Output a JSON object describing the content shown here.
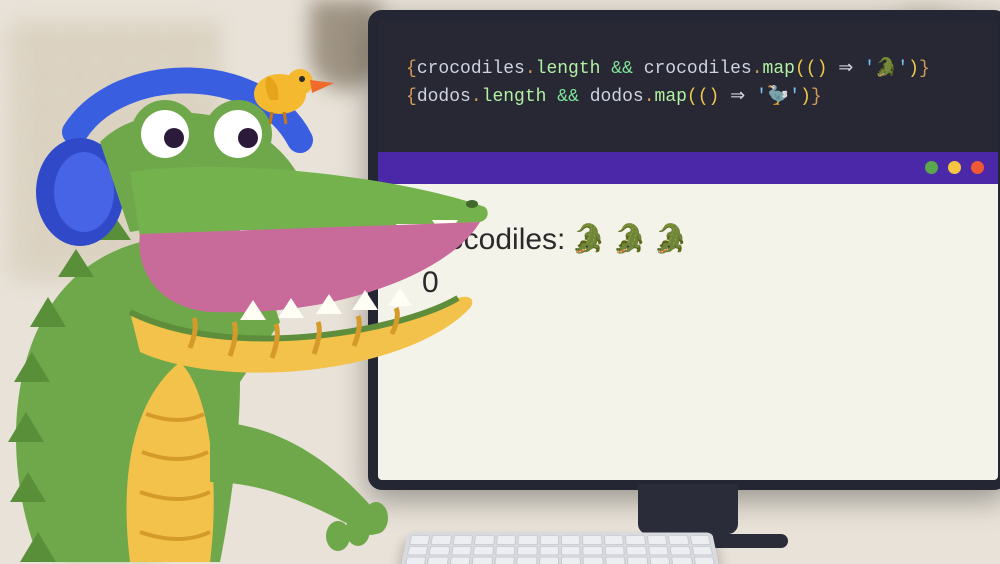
{
  "code": {
    "line1": {
      "open": "{",
      "ident1": "crocodiles",
      "dot1": ".",
      "prop1": "length",
      "sp1": " ",
      "and": "&&",
      "sp2": " ",
      "ident2": "crocodiles",
      "dot2": ".",
      "prop2": "map",
      "paren_open": "((",
      "paren_close1": ")",
      "sp3": " ",
      "arrow": "⇒",
      "sp4": " ",
      "str_open": "'",
      "emoji": "🐊",
      "str_close": "'",
      "paren_close2": ")",
      "close": "}"
    },
    "line2": {
      "open": "{",
      "ident1": "dodos",
      "dot1": ".",
      "prop1": "length",
      "sp1": " ",
      "and": "&&",
      "sp2": " ",
      "ident2": "dodos",
      "dot2": ".",
      "prop2": "map",
      "paren_open": "((",
      "paren_close1": ")",
      "sp3": " ",
      "arrow": "⇒",
      "sp4": " ",
      "str_open": "'",
      "emoji": "🦤",
      "str_close": "'",
      "paren_close2": ")",
      "close": "}"
    }
  },
  "output": {
    "label": "crocodiles:",
    "croc1": "🐊",
    "croc2": "🐊",
    "croc3": "🐊",
    "zero": "0"
  },
  "window": {
    "dots": {
      "green": "#5aa84b",
      "yellow": "#f4c542",
      "red": "#ef5a34"
    }
  }
}
